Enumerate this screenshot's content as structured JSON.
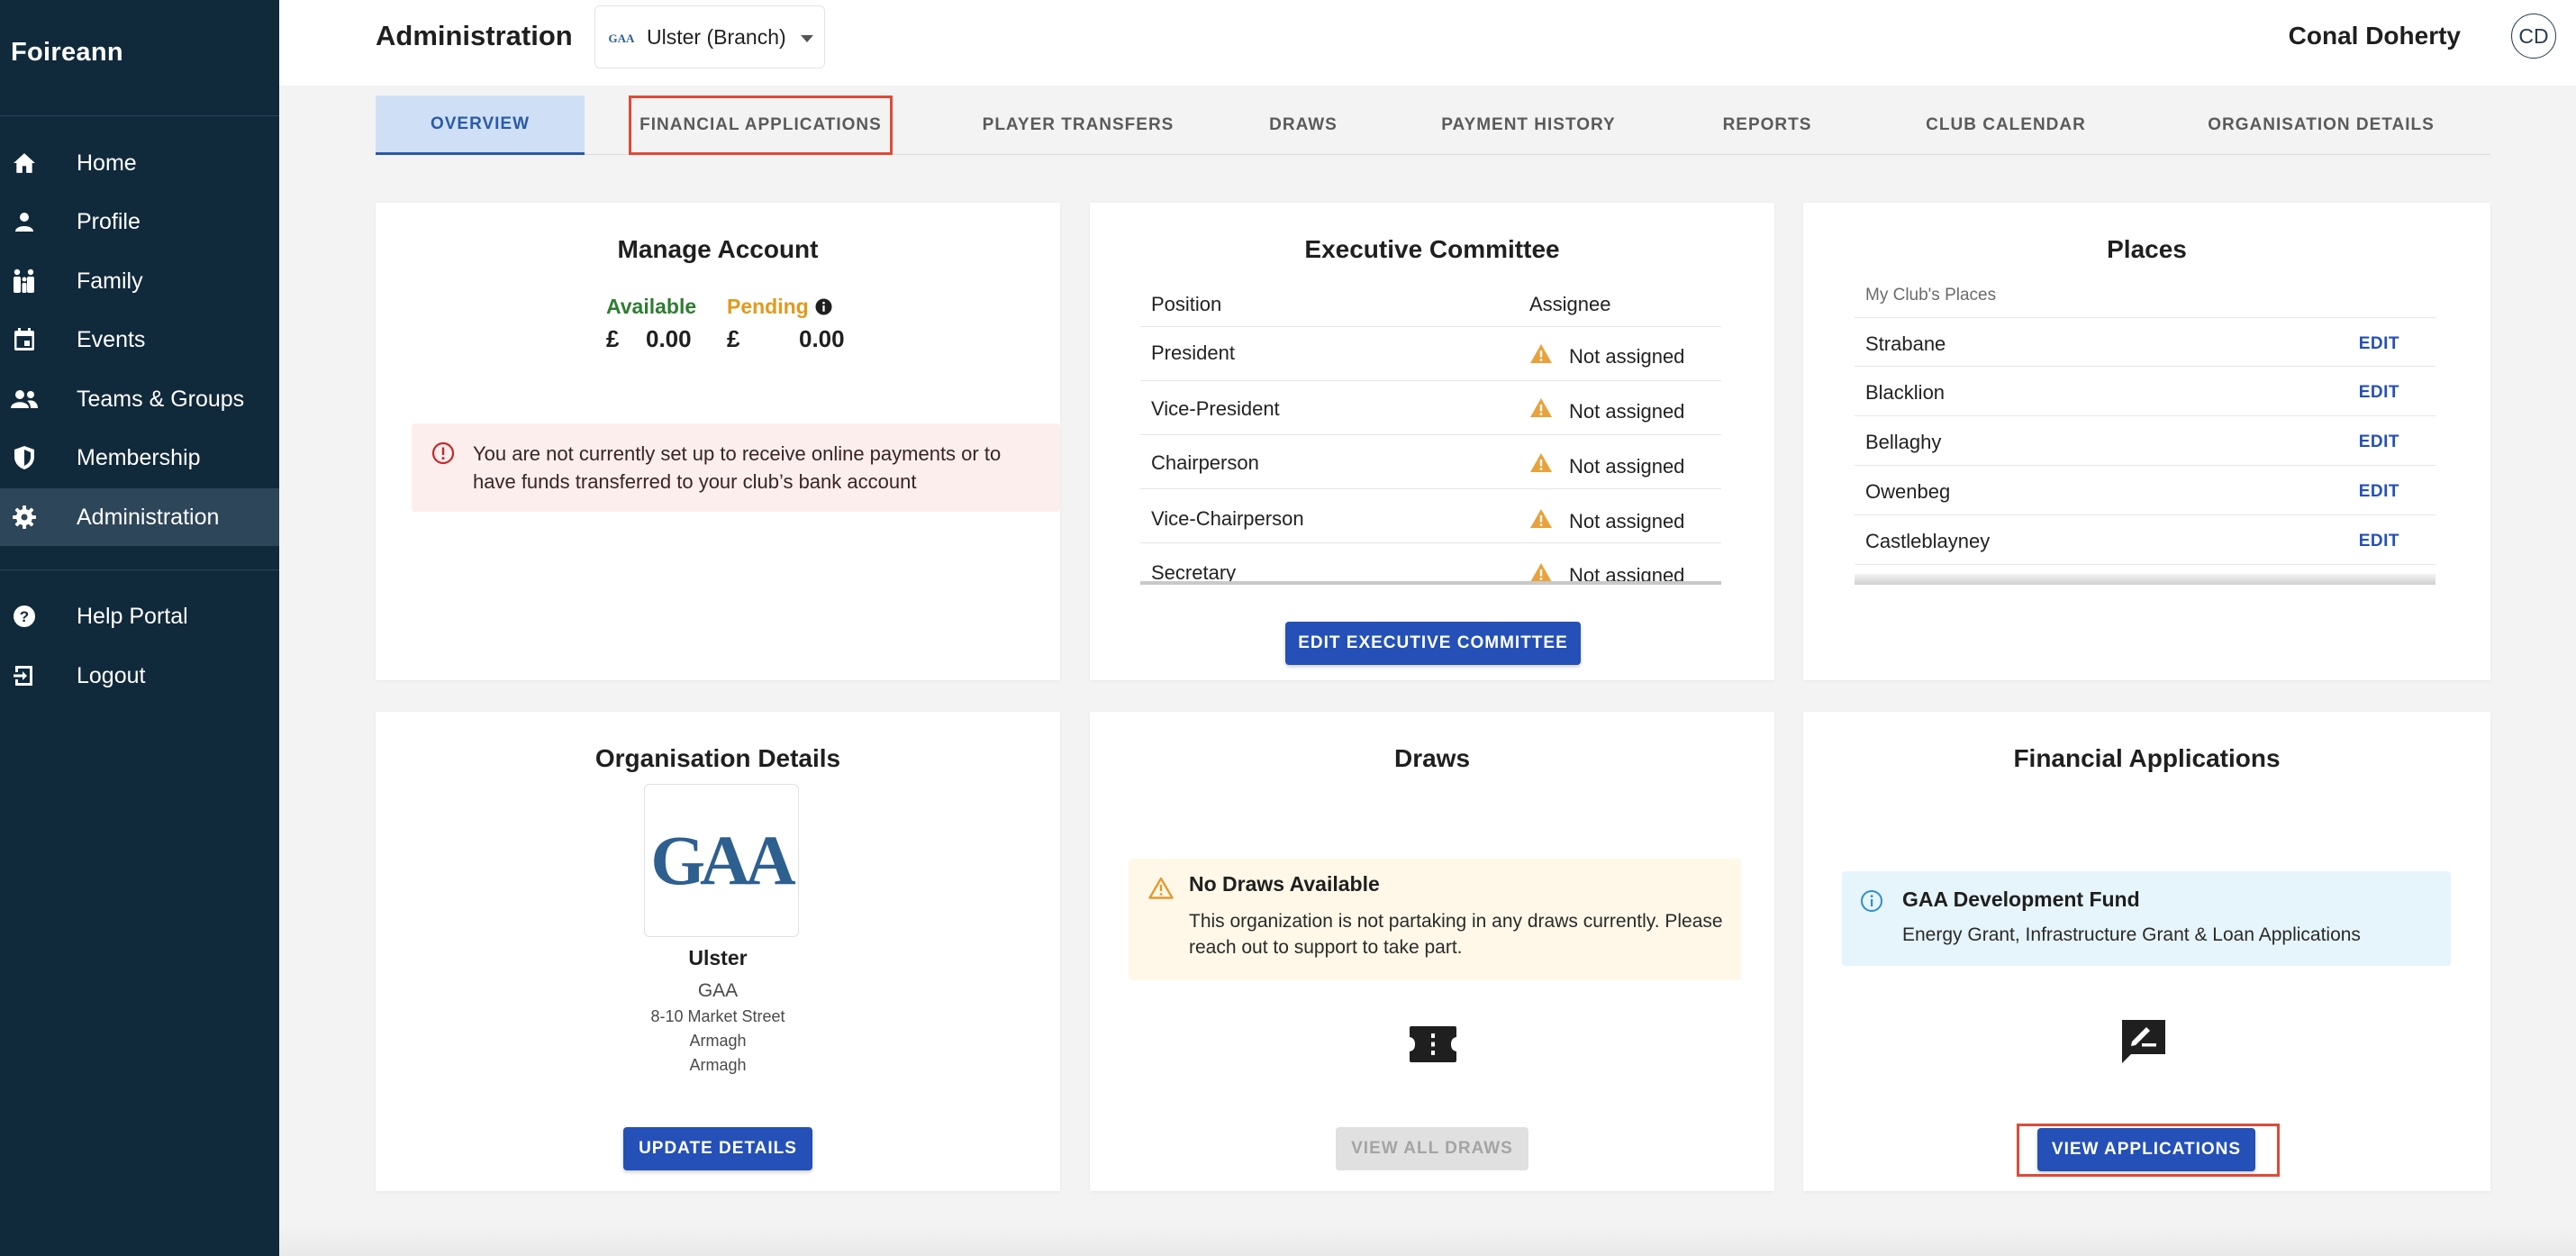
{
  "sidebar": {
    "brand": "Foireann",
    "items": [
      {
        "label": "Home",
        "icon": "home-icon"
      },
      {
        "label": "Profile",
        "icon": "person-icon"
      },
      {
        "label": "Family",
        "icon": "family-icon"
      },
      {
        "label": "Events",
        "icon": "calendar-icon"
      },
      {
        "label": "Teams & Groups",
        "icon": "groups-icon"
      },
      {
        "label": "Membership",
        "icon": "shield-icon"
      },
      {
        "label": "Administration",
        "icon": "gear-icon"
      },
      {
        "label": "Help Portal",
        "icon": "help-icon"
      },
      {
        "label": "Logout",
        "icon": "logout-icon"
      }
    ]
  },
  "header": {
    "title": "Administration",
    "org_select": "Ulster (Branch)",
    "user_name": "Conal Doherty",
    "avatar_initials": "CD"
  },
  "tabs": [
    {
      "label": "OVERVIEW"
    },
    {
      "label": "FINANCIAL APPLICATIONS"
    },
    {
      "label": "PLAYER TRANSFERS"
    },
    {
      "label": "DRAWS"
    },
    {
      "label": "PAYMENT HISTORY"
    },
    {
      "label": "REPORTS"
    },
    {
      "label": "CLUB CALENDAR"
    },
    {
      "label": "ORGANISATION DETAILS"
    }
  ],
  "manage_account": {
    "title": "Manage Account",
    "available_label": "Available",
    "available_currency": "£",
    "available_value": "0.00",
    "pending_label": "Pending",
    "pending_currency": "£",
    "pending_value": "0.00",
    "alert": "You are not currently set up to receive online payments or to have funds transferred to your club’s bank account"
  },
  "executive_committee": {
    "title": "Executive Committee",
    "col_position": "Position",
    "col_assignee": "Assignee",
    "rows": [
      {
        "position": "President",
        "assignee": "Not assigned"
      },
      {
        "position": "Vice-President",
        "assignee": "Not assigned"
      },
      {
        "position": "Chairperson",
        "assignee": "Not assigned"
      },
      {
        "position": "Vice-Chairperson",
        "assignee": "Not assigned"
      },
      {
        "position": "Secretary",
        "assignee": "Not assigned"
      }
    ],
    "button": "EDIT EXECUTIVE COMMITTEE"
  },
  "places": {
    "title": "Places",
    "subheading": "My Club's Places",
    "edit_label": "EDIT",
    "rows": [
      "Strabane",
      "Blacklion",
      "Bellaghy",
      "Owenbeg",
      "Castleblayney"
    ]
  },
  "organisation_details": {
    "title": "Organisation Details",
    "logo_text": "GAA",
    "name": "Ulster",
    "type": "GAA",
    "address_line1": "8-10 Market Street",
    "address_line2": "Armagh",
    "address_line3": "Armagh",
    "button": "UPDATE DETAILS"
  },
  "draws": {
    "title": "Draws",
    "alert_title": "No Draws Available",
    "alert_body": "This organization is not partaking in any draws currently. Please reach out to support to take part.",
    "button": "VIEW ALL DRAWS"
  },
  "financial_applications": {
    "title": "Financial Applications",
    "info_title": "GAA Development Fund",
    "info_body": "Energy Grant, Infrastructure Grant & Loan Applications",
    "button": "VIEW APPLICATIONS"
  },
  "colors": {
    "sidebar_bg": "#10293b",
    "primary": "#2450b7",
    "available": "#2e7d32",
    "pending": "#e19a1d",
    "highlight": "#e04a37"
  }
}
